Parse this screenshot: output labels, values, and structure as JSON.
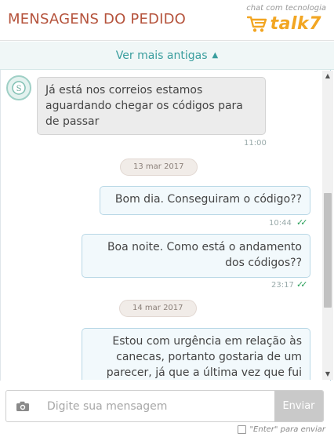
{
  "header": {
    "title": "MENSAGENS DO PEDIDO",
    "powered_by": "chat com tecnologia",
    "brand": "talk7",
    "brand_color": "#f2a623",
    "title_color": "#b5533c"
  },
  "older": {
    "label": "Ver mais antigas",
    "icon": "chevron-up-icon"
  },
  "messages": [
    {
      "direction": "in",
      "text": "Já está nos correios estamos aguardando chegar os códigos para de passar",
      "time": "11:00"
    },
    {
      "type": "date",
      "text": "13 mar 2017"
    },
    {
      "direction": "out",
      "text": "Bom dia. Conseguiram o código??",
      "time": "10:44",
      "status": "read"
    },
    {
      "direction": "out",
      "text": "Boa noite. Como está o andamento dos códigos??",
      "time": "23:17",
      "status": "read"
    },
    {
      "type": "date",
      "text": "14 mar 2017"
    },
    {
      "direction": "out",
      "text": "Estou com urgência em relação às canecas, portanto gostaria de um parecer, já que a última vez que fui",
      "status": "partial"
    }
  ],
  "composer": {
    "placeholder": "Digite sua mensagem",
    "value": "",
    "send_label": "Enviar",
    "camera_icon": "camera-icon"
  },
  "enter_option": {
    "label": "\"Enter\" para enviar",
    "checked": false
  },
  "colors": {
    "accent": "#3a9e9e",
    "read_check": "#2aa05a",
    "outgoing_bubble": "#f2f9fc",
    "incoming_bubble": "#ececec"
  }
}
